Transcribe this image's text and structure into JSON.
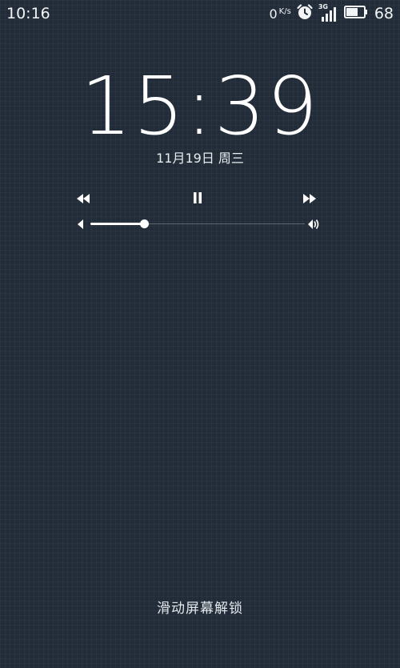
{
  "status_bar": {
    "time": "10:16",
    "net_speed_value": "0",
    "net_speed_unit": "K/s",
    "network_type": "3G",
    "battery_level": 68,
    "battery_percent_text": "68",
    "icons": [
      "alarm-clock-icon",
      "signal-3g-icon",
      "battery-icon"
    ]
  },
  "lockscreen": {
    "clock": "15:39",
    "date": "11月19日 周三",
    "unlock_hint": "滑动屏幕解锁"
  },
  "media": {
    "controls": [
      "previous-track-icon",
      "pause-icon",
      "next-track-icon"
    ],
    "volume_level": 0.25
  },
  "colors": {
    "background": "#212c38",
    "text": "#ffffff"
  }
}
